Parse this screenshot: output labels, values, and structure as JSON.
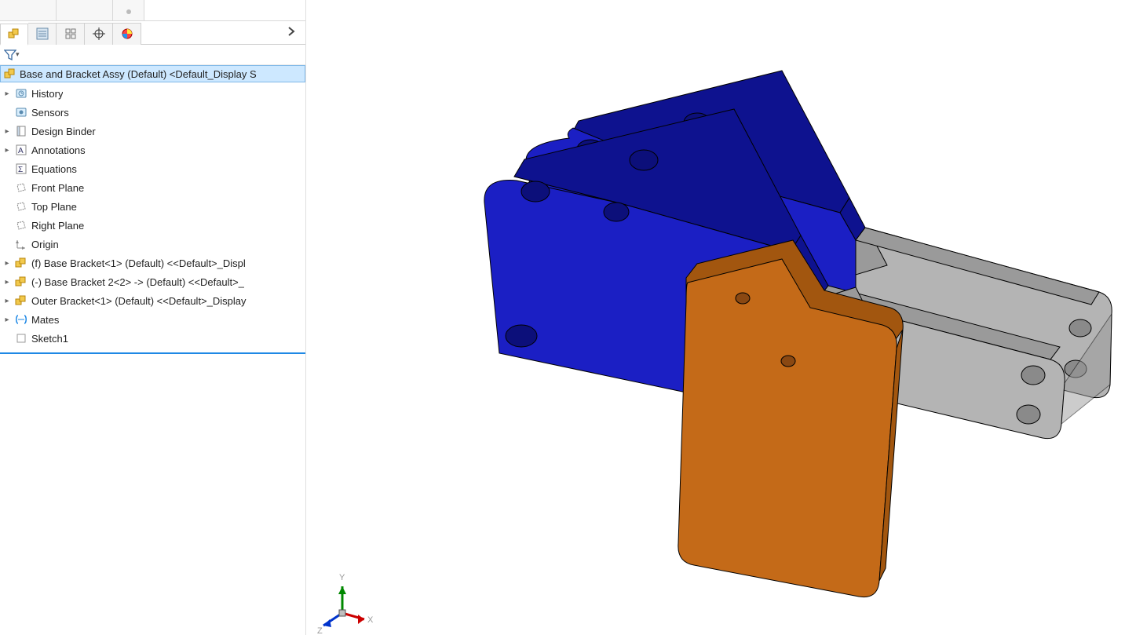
{
  "root": {
    "label": "Base and Bracket Assy (Default) <Default_Display S"
  },
  "tree": [
    {
      "twisty": "▸",
      "icon": "history-icon",
      "label": "History"
    },
    {
      "twisty": "",
      "icon": "sensors-icon",
      "label": "Sensors"
    },
    {
      "twisty": "▸",
      "icon": "binder-icon",
      "label": "Design Binder"
    },
    {
      "twisty": "▸",
      "icon": "annotations-icon",
      "label": "Annotations"
    },
    {
      "twisty": "",
      "icon": "equations-icon",
      "label": "Equations"
    },
    {
      "twisty": "",
      "icon": "plane-icon",
      "label": "Front Plane"
    },
    {
      "twisty": "",
      "icon": "plane-icon",
      "label": "Top Plane"
    },
    {
      "twisty": "",
      "icon": "plane-icon",
      "label": "Right Plane"
    },
    {
      "twisty": "",
      "icon": "origin-icon",
      "label": "Origin"
    },
    {
      "twisty": "▸",
      "icon": "part-icon",
      "label": "(f) Base Bracket<1> (Default) <<Default>_Displ"
    },
    {
      "twisty": "▸",
      "icon": "part-icon",
      "label": "(-) Base Bracket 2<2> -> (Default) <<Default>_"
    },
    {
      "twisty": "▸",
      "icon": "part-icon",
      "label": "Outer Bracket<1> (Default) <<Default>_Display"
    },
    {
      "twisty": "▸",
      "icon": "mates-icon",
      "label": "Mates"
    },
    {
      "twisty": "",
      "icon": "sketch-icon",
      "label": "Sketch1"
    }
  ],
  "triad": {
    "x": "X",
    "y": "Y",
    "z": "Z"
  },
  "colors": {
    "blue_face": "#1b1fc4",
    "blue_top": "#0e128f",
    "grey_face": "#b4b4b4",
    "grey_top": "#9a9a9a",
    "orange_face": "#c46a18",
    "orange_top": "#a2560f",
    "edge": "#000000"
  }
}
